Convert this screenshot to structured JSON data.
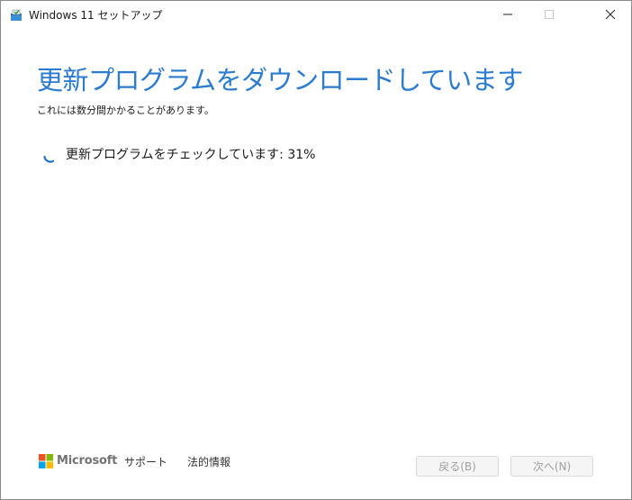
{
  "window": {
    "title": "Windows 11 セットアップ"
  },
  "content": {
    "heading": "更新プログラムをダウンロードしています",
    "subtext": "これには数分間かかることがあります。",
    "status": "更新プログラムをチェックしています: 31%"
  },
  "footer": {
    "brand": "Microsoft",
    "support_link": "サポート",
    "legal_link": "法的情報",
    "back_button": "戻る(B)",
    "next_button": "次へ(N)"
  },
  "colors": {
    "accent": "#2b7bd0",
    "ms_red": "#f25022",
    "ms_green": "#7fba00",
    "ms_blue": "#00a4ef",
    "ms_yellow": "#ffb900"
  },
  "icons": {
    "app": "setup-app-icon",
    "minimize": "minimize-icon",
    "maximize": "maximize-icon",
    "close": "close-icon",
    "spinner": "loading-spinner-icon",
    "logo": "microsoft-logo"
  }
}
